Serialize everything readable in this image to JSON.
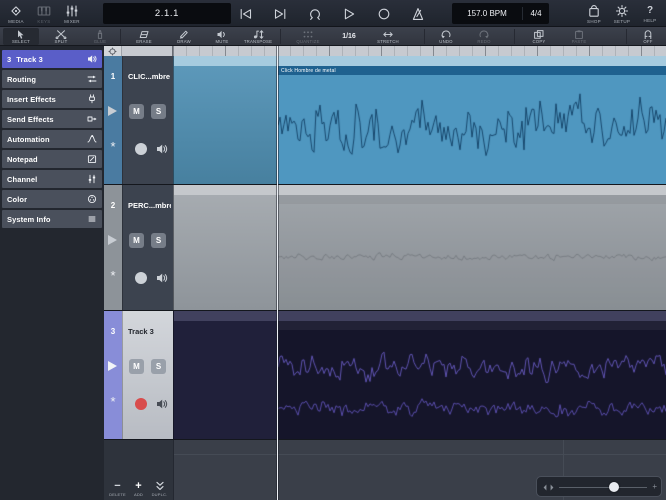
{
  "topbar": {
    "media_label": "MEDIA",
    "keys_label": "KEYS",
    "mixer_label": "MIXER",
    "position_display": "2.1.1",
    "bpm_display": "157.0 BPM",
    "time_signature": "4/4",
    "shop_label": "SHOP",
    "setup_label": "SETUP",
    "help_label": "HELP"
  },
  "toolbar": {
    "tools": [
      {
        "label": "SELECT",
        "state": "active"
      },
      {
        "label": "SPLIT",
        "state": "normal"
      },
      {
        "label": "GLUE",
        "state": "disabled"
      },
      {
        "label": "ERASE",
        "state": "normal"
      },
      {
        "label": "DRAW",
        "state": "normal"
      },
      {
        "label": "MUTE",
        "state": "normal"
      },
      {
        "label": "TRANSPOSE",
        "state": "normal"
      },
      {
        "label": "QUANTIZE",
        "state": "disabled"
      },
      {
        "label": "1/16",
        "state": "normal"
      },
      {
        "label": "STRETCH",
        "state": "normal"
      },
      {
        "label": "UNDO",
        "state": "normal"
      },
      {
        "label": "REDO",
        "state": "disabled"
      },
      {
        "label": "COPY",
        "state": "normal"
      },
      {
        "label": "PASTE",
        "state": "disabled"
      },
      {
        "label": "OFF",
        "state": "normal"
      }
    ]
  },
  "inspector": {
    "items": [
      {
        "number": "3",
        "label": "Track 3",
        "icon": "speaker",
        "selected": true
      },
      {
        "label": "Routing",
        "icon": "routing",
        "selected": false
      },
      {
        "label": "Insert Effects",
        "icon": "insert-plug",
        "selected": false
      },
      {
        "label": "Send Effects",
        "icon": "send-arrow",
        "selected": false
      },
      {
        "label": "Automation",
        "icon": "automation-curve",
        "selected": false
      },
      {
        "label": "Notepad",
        "icon": "notepad-pencil",
        "selected": false
      },
      {
        "label": "Channel",
        "icon": "channel-fader",
        "selected": false
      },
      {
        "label": "Color",
        "icon": "color-palette",
        "selected": false
      },
      {
        "label": "System Info",
        "icon": "system-info-lines",
        "selected": false
      }
    ]
  },
  "controls": {
    "mute": "M",
    "solo": "S"
  },
  "tracks": [
    {
      "number": "1",
      "name": "CLIC...mbre",
      "clip_title": "Click Hombre de metal",
      "waveform": {
        "lines": [
          {
            "color": "#0e3a5e",
            "center": 0.46,
            "amp": 0.42,
            "seed": 7,
            "alpha": 0.85
          }
        ]
      }
    },
    {
      "number": "2",
      "name": "PERC...mbre",
      "clip_title": "",
      "waveform": {
        "lines": [
          {
            "color": "#3c4248",
            "center": 0.5,
            "amp": 0.06,
            "seed": 21,
            "alpha": 0.3
          }
        ]
      }
    },
    {
      "number": "3",
      "name": "Track 3",
      "clip_title": "",
      "waveform": {
        "lines": [
          {
            "color": "#6457bb",
            "center": 0.34,
            "amp": 0.2,
            "seed": 3,
            "alpha": 0.95
          },
          {
            "color": "#5d50b2",
            "center": 0.72,
            "amp": 0.12,
            "seed": 15,
            "alpha": 0.95
          }
        ]
      }
    }
  ],
  "bottom_bar": {
    "delete_label": "DELETE",
    "add_label": "ADD",
    "duplicate_label": "DUPLC."
  },
  "icons": {
    "minus": "−",
    "plus": "+",
    "question_mark": "?",
    "record_arm_star": "*"
  },
  "colors": {
    "selected_accent": "#5a5ec8",
    "track1_blue": "#4f97c0",
    "track2_gray": "#9aa0a6",
    "track3_dark": "#15152a",
    "record_red": "#d84c4c",
    "playhead": "#eef1f6"
  }
}
